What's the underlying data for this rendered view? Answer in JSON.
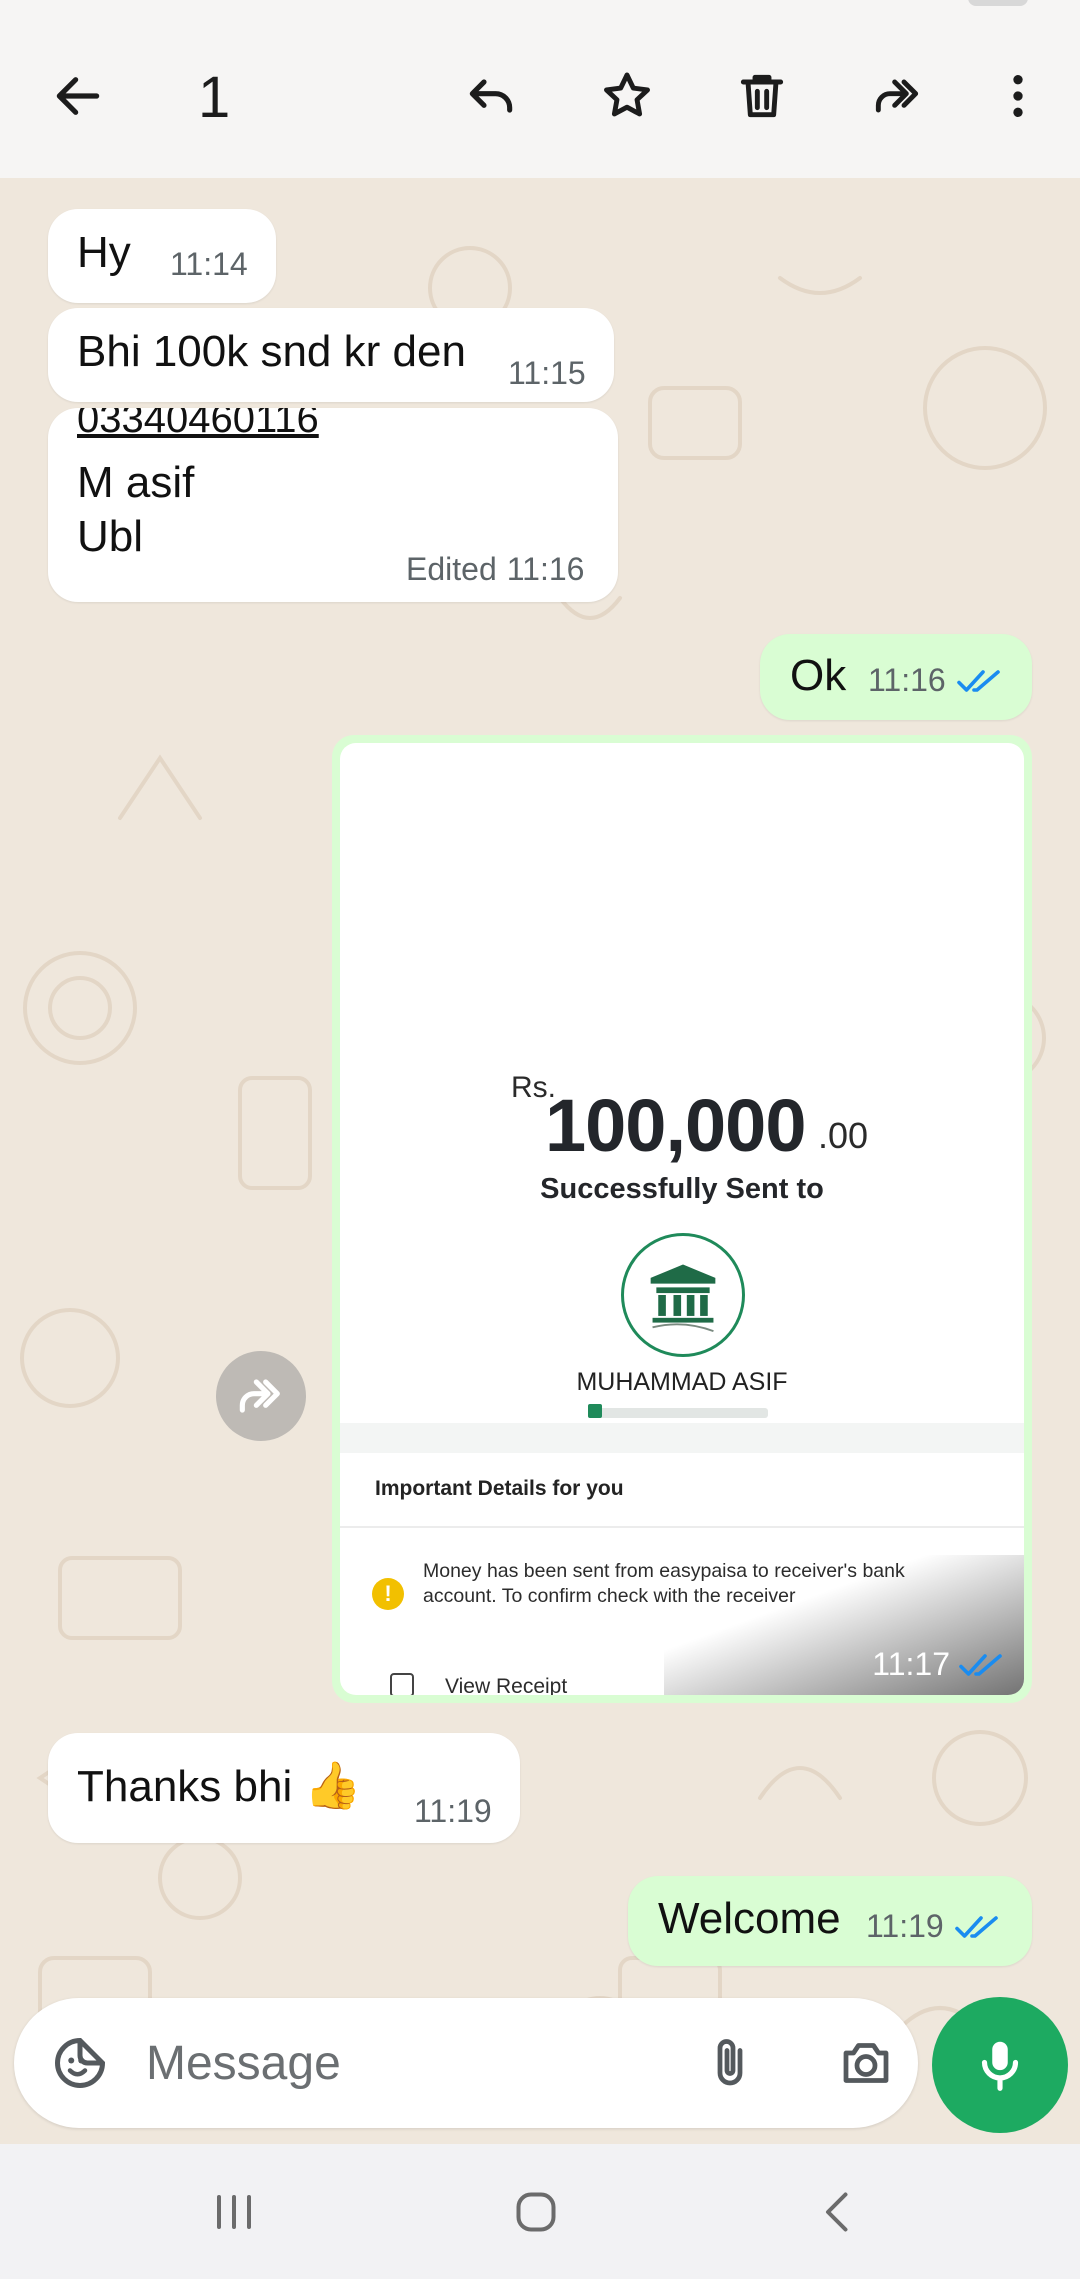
{
  "toolbar": {
    "selected_count": "1",
    "icons": [
      "back-arrow-icon",
      "reply-icon",
      "star-icon",
      "delete-icon",
      "forward-icon",
      "more-icon"
    ]
  },
  "messages": [
    {
      "id": "m1",
      "direction": "in",
      "text": "Hy",
      "time": "11:14"
    },
    {
      "id": "m2",
      "direction": "in",
      "text": "Bhi 100k snd kr den",
      "time": "11:15"
    },
    {
      "id": "m3",
      "direction": "in",
      "link_text": "03340460116",
      "lines": [
        "M asif",
        "Ubl"
      ],
      "edited_label": "Edited",
      "time": "11:16"
    },
    {
      "id": "m4",
      "direction": "out",
      "text": "Ok",
      "time": "11:16",
      "status": "read"
    },
    {
      "id": "m5",
      "direction": "out",
      "type": "image",
      "time": "11:17",
      "status": "read"
    },
    {
      "id": "m6",
      "direction": "in",
      "text": "Thanks bhi",
      "emoji": "👍",
      "time": "11:19"
    },
    {
      "id": "m7",
      "direction": "out",
      "text": "Welcome",
      "time": "11:19",
      "status": "read"
    }
  ],
  "receipt": {
    "currency": "Rs.",
    "amount": "100,000",
    "cents": ".00",
    "sent_to_label": "Successfully Sent to",
    "payee": "MUHAMMAD ASIF",
    "details_heading": "Important Details for you",
    "warning_icon": "!",
    "warning_text": "Money has been sent from easypaisa to receiver's bank account. To confirm check with the receiver",
    "view_receipt": "View Receipt"
  },
  "composer": {
    "placeholder": "Message"
  },
  "colors": {
    "outgoing_bubble": "#d9fdd3",
    "incoming_bubble": "#ffffff",
    "read_tick": "#1a8cf0",
    "mic_button": "#1daa61",
    "wallpaper": "#efe7dc"
  }
}
